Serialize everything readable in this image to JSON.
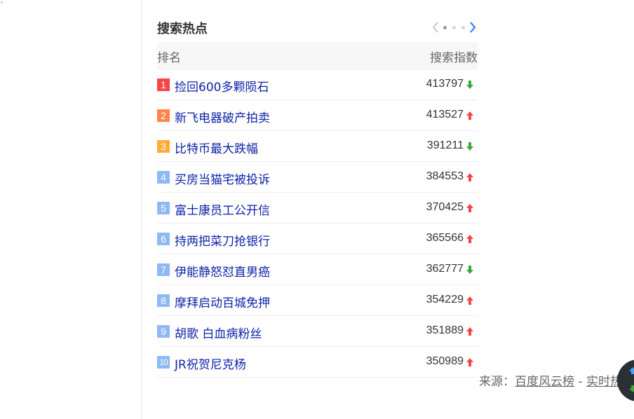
{
  "panel": {
    "title": "搜索热点",
    "pager": {
      "pages": 3,
      "current": 1
    }
  },
  "table": {
    "col_rank": "排名",
    "col_index": "搜索指数",
    "rows": [
      {
        "rank": "1",
        "title": "捡回600多颗陨石",
        "index": "413797",
        "trend": "down",
        "badge_color": "#f54545"
      },
      {
        "rank": "2",
        "title": "新飞电器破产拍卖",
        "index": "413527",
        "trend": "up",
        "badge_color": "#ff8547"
      },
      {
        "rank": "3",
        "title": "比特币最大跌幅",
        "index": "391211",
        "trend": "down",
        "badge_color": "#ffac38"
      },
      {
        "rank": "4",
        "title": "买房当猫宅被投诉",
        "index": "384553",
        "trend": "up",
        "badge_color": "#8eb9f5"
      },
      {
        "rank": "5",
        "title": "富士康员工公开信",
        "index": "370425",
        "trend": "up",
        "badge_color": "#8eb9f5"
      },
      {
        "rank": "6",
        "title": "持两把菜刀抢银行",
        "index": "365566",
        "trend": "up",
        "badge_color": "#8eb9f5"
      },
      {
        "rank": "7",
        "title": "伊能静怒怼直男癌",
        "index": "362777",
        "trend": "down",
        "badge_color": "#8eb9f5"
      },
      {
        "rank": "8",
        "title": "摩拜启动百城免押",
        "index": "354229",
        "trend": "up",
        "badge_color": "#8eb9f5"
      },
      {
        "rank": "9",
        "title": "胡歌 白血病粉丝",
        "index": "351889",
        "trend": "up",
        "badge_color": "#8eb9f5"
      },
      {
        "rank": "10",
        "title": "JR祝贺尼克杨",
        "index": "350989",
        "trend": "up",
        "badge_color": "#8eb9f5"
      }
    ]
  },
  "source": {
    "label": "来源：",
    "link1": "百度风云榜",
    "separator": " - ",
    "link2": "实时热点"
  },
  "colors": {
    "trend_up": "#f54545",
    "trend_down": "#3aa93a",
    "link": "#0e23a8",
    "pager_active": "#3385ff"
  }
}
